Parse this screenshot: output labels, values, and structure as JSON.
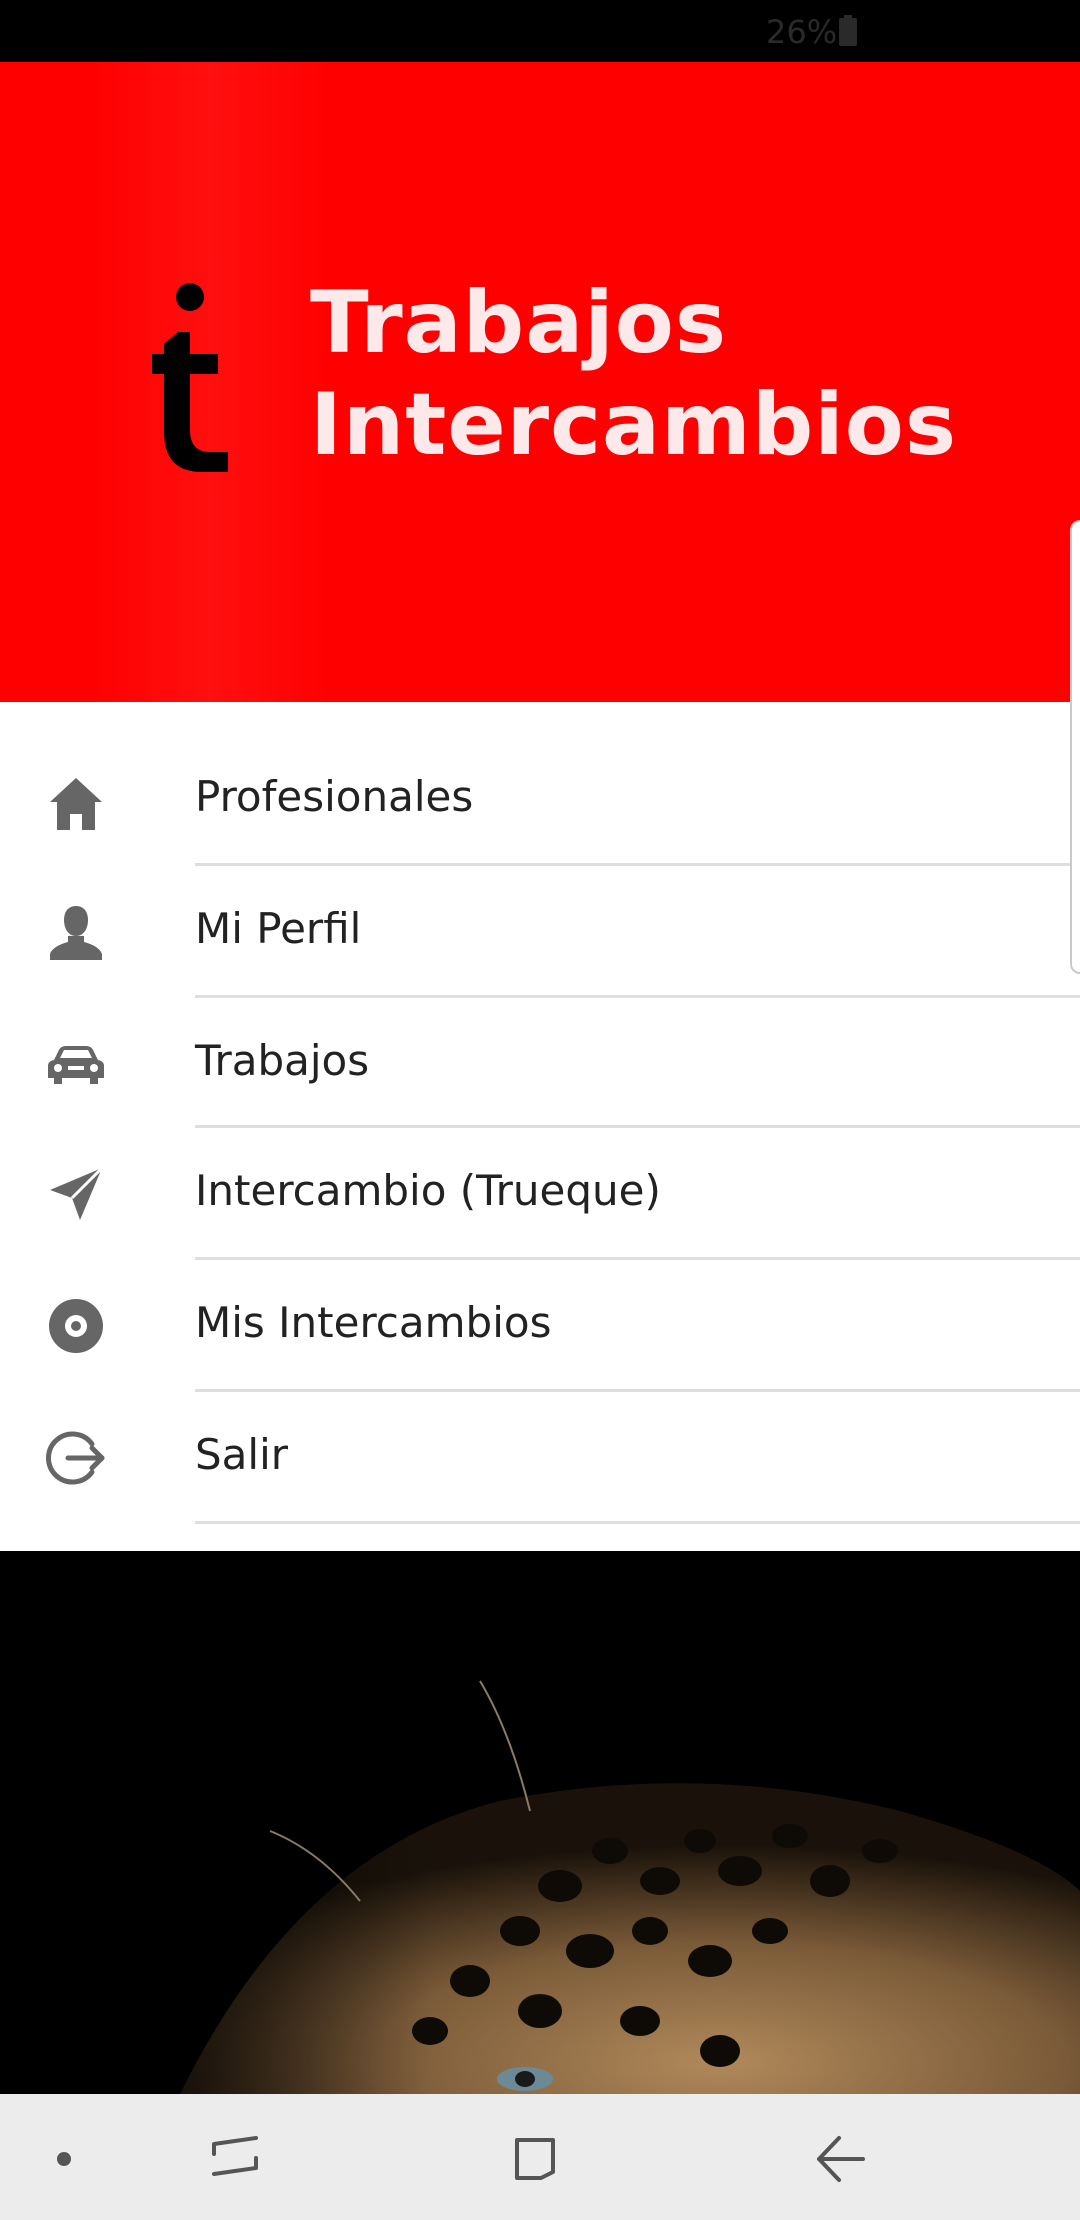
{
  "status_bar": {
    "battery_percent": "26%"
  },
  "header": {
    "title_line1": "Trabajos",
    "title_line2": "Intercambios",
    "logo_icon": "t-logo-icon",
    "background_color": "#ff0000"
  },
  "menu": {
    "items": [
      {
        "label": "Profesionales",
        "icon": "home-icon"
      },
      {
        "label": "Mi Perfil",
        "icon": "person-icon"
      },
      {
        "label": "Trabajos",
        "icon": "car-icon"
      },
      {
        "label": "Intercambio (Trueque)",
        "icon": "send-icon"
      },
      {
        "label": "Mis Intercambios",
        "icon": "disc-icon"
      },
      {
        "label": "Salir",
        "icon": "logout-icon"
      }
    ],
    "icon_color": "#666666"
  },
  "background_image": {
    "subject": "jaguar"
  },
  "nav_bar": {
    "buttons": [
      {
        "name": "dot-button"
      },
      {
        "name": "recents-button"
      },
      {
        "name": "home-button"
      },
      {
        "name": "back-button"
      }
    ]
  }
}
